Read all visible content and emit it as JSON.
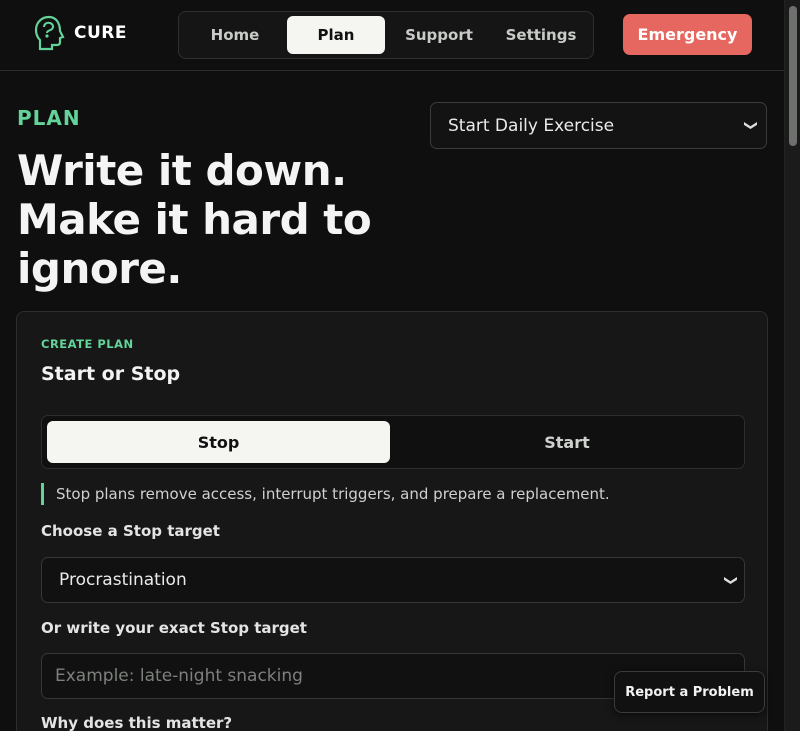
{
  "brand": {
    "name": "CURE",
    "icon": "head-icon"
  },
  "nav": {
    "items": [
      {
        "label": "Home"
      },
      {
        "label": "Plan"
      },
      {
        "label": "Support"
      },
      {
        "label": "Settings"
      }
    ],
    "active": "Plan",
    "emergency_label": "Emergency"
  },
  "page": {
    "section_label": "PLAN",
    "headline": "Write it down. Make it hard to ignore.",
    "quick_select": {
      "value": "Start Daily Exercise"
    }
  },
  "card": {
    "eyebrow": "CREATE PLAN",
    "title": "Start or Stop",
    "toggle": {
      "stop_label": "Stop",
      "start_label": "Start",
      "selected": "Stop"
    },
    "hint": "Stop plans remove access, interrupt triggers, and prepare a replacement.",
    "target_select": {
      "label": "Choose a Stop target",
      "value": "Procrastination"
    },
    "target_input": {
      "label": "Or write your exact Stop target",
      "placeholder": "Example: late-night snacking",
      "value": ""
    },
    "why_label": "Why does this matter?"
  },
  "report_label": "Report a Problem",
  "colors": {
    "accent": "#63d39a",
    "emergency": "#e5675f",
    "background": "#0e0f0e"
  }
}
